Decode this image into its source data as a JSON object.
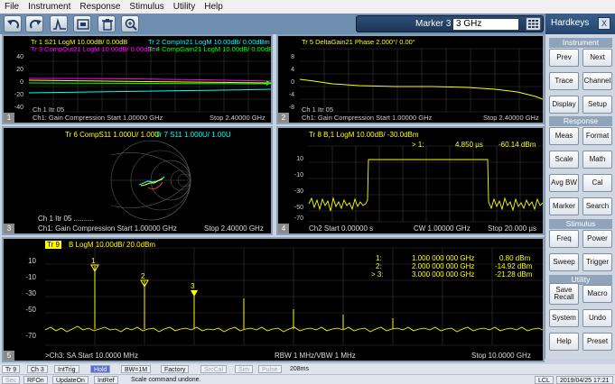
{
  "menu": [
    "File",
    "Instrument",
    "Response",
    "Stimulus",
    "Utility",
    "Help"
  ],
  "toolbar": {
    "buttons": [
      "undo-icon",
      "redo-icon",
      "preset-icon",
      "save-icon",
      "delete-icon",
      "zoom-icon"
    ],
    "marker_label": "Marker 3",
    "marker_value": "3 GHz"
  },
  "hardkeys": {
    "title": "Hardkeys",
    "close": "X",
    "sections": {
      "instrument": "Instrument",
      "response": "Response",
      "stimulus": "Stimulus",
      "utility": "Utility"
    },
    "buttons": {
      "prev": "Prev",
      "next": "Next",
      "trace": "Trace",
      "channel": "Channel",
      "display": "Display",
      "setup": "Setup",
      "meas": "Meas",
      "format": "Format",
      "scale": "Scale",
      "math": "Math",
      "avgbw": "Avg BW",
      "cal": "Cal",
      "marker": "Marker",
      "search": "Search",
      "freq": "Freq",
      "power": "Power",
      "sweep": "Sweep",
      "trigger": "Trigger",
      "saverecall1": "Save",
      "saverecall2": "Recall",
      "macro": "Macro",
      "system": "System",
      "undo": "Undo",
      "help": "Help",
      "preset": "Preset"
    }
  },
  "win1": {
    "tr1": "Tr 1  S21 LogM 10.00dB/ 0.00dB",
    "tr2": "Tr 2  CompIn21 LogM 10.00dB/ 0.00dBm",
    "tr3": "Tr 3  CompOut21 LogM 10.00dB/ 0.00dBm",
    "tr4": "Tr 4  CompGain21 LogM 10.00dB/ 0.00dB",
    "yticks": [
      "40",
      "20",
      "0",
      "-20",
      "-40"
    ],
    "ch": "Ch 1  Itr 05",
    "footer_left": "Ch1: Gain Compression  Start  1.00000 GHz",
    "footer_right": "Stop  2.40000 GHz",
    "num": "1"
  },
  "win2": {
    "tr5": "Tr 5  DeltaGain21 Phase 2.000°/ 0.00°",
    "yticks": [
      "8",
      "4",
      "0",
      "-4",
      "-8"
    ],
    "ch": "Ch 1  Itr 05",
    "footer_left": "Ch1: Gain Compression  Start  1.00000 GHz",
    "footer_right": "Stop  2.40000 GHz",
    "num": "2"
  },
  "win3": {
    "tr6": "Tr 6  CompS11 1.000U/  1.00U",
    "tr7": "Tr 7  S11 1.000U/  1.00U",
    "ch": "Ch 1  Itr 05 ..........",
    "footer_left": "Ch1: Gain Compression  Start  1.00000 GHz",
    "footer_right": "Stop  2.40000 GHz",
    "num": "3"
  },
  "win4": {
    "tr8": "Tr 8  B,1 LogM 10.00dB/ -30.0dBm",
    "marker": "> 1:",
    "marker_x": "4.850  µs",
    "marker_y": "-60.14 dBm",
    "yticks": [
      "10",
      "-10",
      "-30",
      "-50",
      "-70"
    ],
    "footer_left": "Ch2  Start  0.00000 s",
    "footer_mid": "CW  1.00000 GHz",
    "footer_right": "Stop  20.000 µs",
    "num": "4"
  },
  "win5": {
    "tr9": "Tr 9",
    "tr9_text": "B LogM 10.00dB/  20.0dBm",
    "markers": [
      {
        "id": "1:",
        "freq": "1.000 000 000 GHz",
        "val": "0.80 dBm"
      },
      {
        "id": "2:",
        "freq": "2.000 000 000 GHz",
        "val": "-14.92 dBm"
      },
      {
        "id": "> 3:",
        "freq": "3.000 000 000 GHz",
        "val": "-21.28 dBm"
      }
    ],
    "marker_tags": [
      "1",
      "2",
      "3"
    ],
    "yticks": [
      "10",
      "-10",
      "-30",
      "-50",
      "-70"
    ],
    "footer_left": ">Ch3: SA  Start  10.0000 MHz",
    "footer_mid": "RBW  1 MHz/VBW  1 MHz",
    "footer_right": "Stop  10.0000 GHz",
    "num": "5"
  },
  "status1": [
    "Tr 9",
    "Ch 3",
    "IntTrig",
    "Hold",
    "BW=1M",
    "Factory",
    "SrcCal",
    "Sim",
    "Pulse",
    "208ms"
  ],
  "status2": [
    "Sec",
    "RFOn",
    "UpdateOn",
    "IntRef",
    "Scale command undone.",
    "LCL",
    "2019/04/25 17:21"
  ],
  "colors": {
    "tr1": "#ffff00",
    "tr2": "#00ffff",
    "tr3": "#ff00ff",
    "tr4": "#00ff00",
    "accent": "#24466f"
  }
}
